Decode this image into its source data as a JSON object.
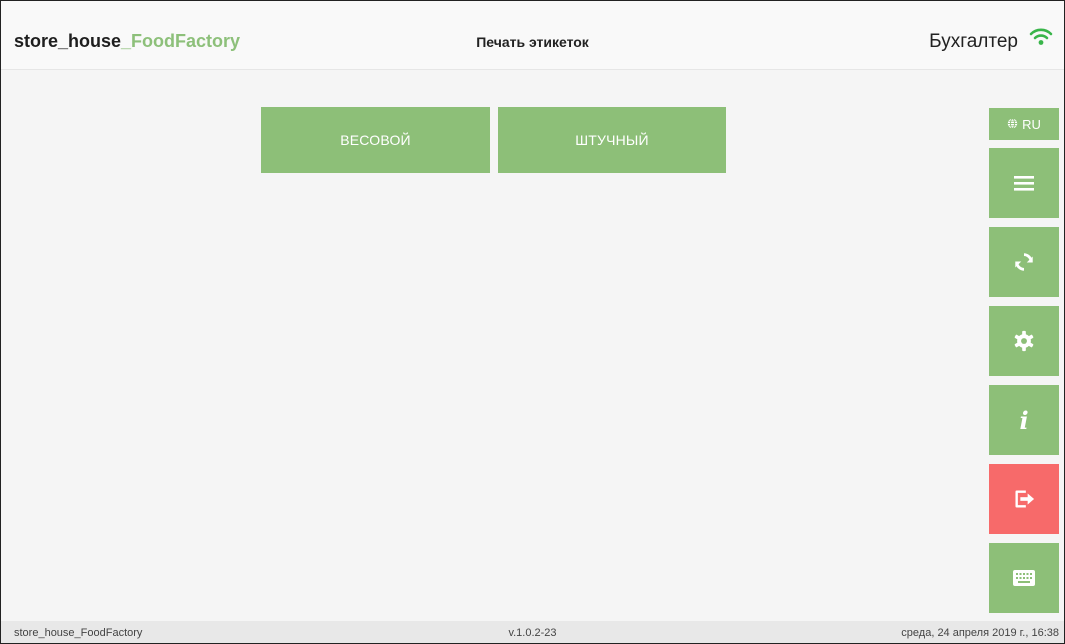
{
  "header": {
    "logo_prefix": "store_house",
    "logo_accent": "_FoodFactory",
    "page_title": "Печать этикеток",
    "user": "Бухгалтер"
  },
  "main": {
    "buttons": [
      {
        "label": "ВЕСОВОЙ"
      },
      {
        "label": "ШТУЧНЫЙ"
      }
    ]
  },
  "sidebar": {
    "language": "RU",
    "icons": [
      "globe-icon",
      "menu-icon",
      "sync-icon",
      "settings-icon",
      "info-icon",
      "logout-icon",
      "keyboard-icon"
    ]
  },
  "footer": {
    "app_name": "store_house_FoodFactory",
    "version": "v.1.0.2-23",
    "datetime": "среда, 24 апреля 2019 г., 16:38"
  },
  "colors": {
    "accent": "#8dbf78",
    "danger": "#f76a6a",
    "background": "#f5f5f5"
  }
}
